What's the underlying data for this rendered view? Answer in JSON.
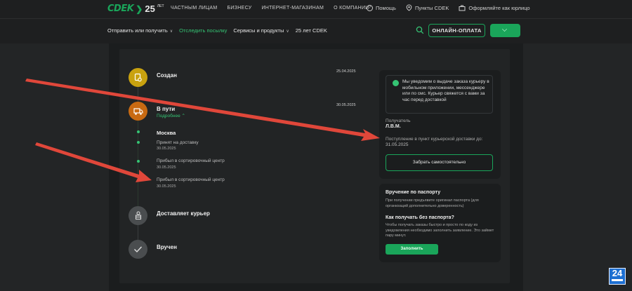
{
  "topbar": {
    "logo": "CDEK",
    "anniversary": "25",
    "anniversary_suffix": "ЛЕТ",
    "links": [
      "ЧАСТНЫМ ЛИЦАМ",
      "БИЗНЕСУ",
      "ИНТЕРНЕТ-МАГАЗИНАМ",
      "О КОМПАНИИ"
    ],
    "help": "Помощь",
    "points": "Пункты CDEK",
    "legal": "Оформляйте как юрлицо"
  },
  "nav": {
    "send": "Отправить или получить",
    "track": "Отследить посылку",
    "services": "Сервисы и продукты",
    "years": "25 лет CDEK",
    "online_pay": "ОНЛАЙН-ОПЛАТА"
  },
  "timeline": {
    "created": {
      "title": "Создан",
      "date": "25.04.2025"
    },
    "transit": {
      "title": "В пути",
      "date": "30.05.2025",
      "more": "Подробнее"
    },
    "city": "Москва",
    "events": [
      {
        "text": "Принят на доставку",
        "date": "30.05.2025"
      },
      {
        "text": "Прибыл в сортировочный центр",
        "date": "30.05.2025"
      },
      {
        "text": "Прибыл в сортировочный центр",
        "date": "30.05.2025"
      }
    ],
    "courier": {
      "title": "Доставляет курьер"
    },
    "delivered": {
      "title": "Вручен"
    }
  },
  "info": {
    "notice": "Мы уведомим о выдаче заказа курьеру в мобильном приложении, мессенджере или по смс. Курьер свяжется с вами за час перед доставкой",
    "recipient_label": "Получатель",
    "recipient": "Л.В.М.",
    "arrival_label": "Поступление в пункт курьерской доставки до:",
    "arrival_date": "31.05.2025",
    "pickup_button": "Забрать самостоятельно"
  },
  "passport": {
    "title": "Вручение по паспорту",
    "text": "При получении предъявите оригинал паспорта (для организаций дополнительно доверенность)",
    "no_passport_title": "Как получать без паспорта?",
    "no_passport_text": "Чтобы получать заказы быстро и просто по коду из уведомления необходимо заполнить заявление. Это займет пару минут.",
    "fill_button": "Заполнить"
  },
  "watermark": "24",
  "colors": {
    "accent": "#1aa55a",
    "created": "#c9a20f",
    "transit": "#c86a12",
    "arrow": "#e0473a"
  }
}
